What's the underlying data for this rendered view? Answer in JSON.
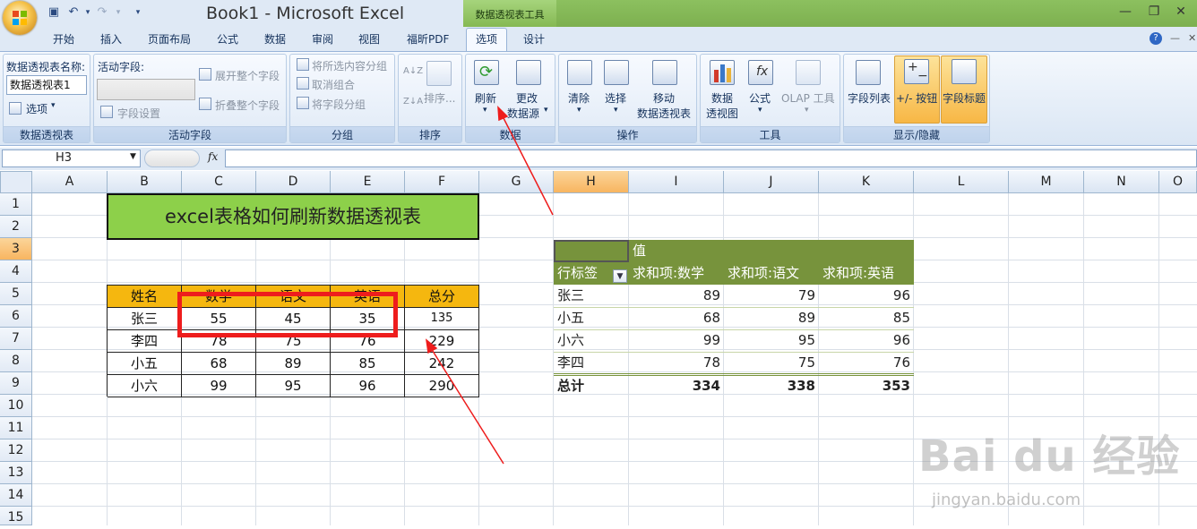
{
  "app": {
    "window_title": "Book1 - Microsoft Excel",
    "context_tab_group": "数据透视表工具"
  },
  "tabs": [
    "开始",
    "插入",
    "页面布局",
    "公式",
    "数据",
    "审阅",
    "视图",
    "福昕PDF",
    "选项",
    "设计"
  ],
  "active_tab": "选项",
  "ribbon": {
    "pivot_group": {
      "name_label": "数据透视表名称:",
      "name_value": "数据透视表1",
      "options": "选项",
      "label": "数据透视表"
    },
    "field_group": {
      "active_field": "活动字段:",
      "expand": "展开整个字段",
      "collapse": "折叠整个字段",
      "field_settings": "字段设置",
      "label": "活动字段"
    },
    "group_group": {
      "group_selection": "将所选内容分组",
      "ungroup": "取消组合",
      "group_field": "将字段分组",
      "label": "分组"
    },
    "sort_group": {
      "sort": "排序...",
      "label": "排序"
    },
    "data_group": {
      "refresh": "刷新",
      "change_1": "更改",
      "change_2": "数据源",
      "label": "数据"
    },
    "actions_group": {
      "clear": "清除",
      "select": "选择",
      "move": "移动",
      "move_2": "数据透视表",
      "label": "操作"
    },
    "tools_group": {
      "pivotchart_1": "数据",
      "pivotchart_2": "透视图",
      "formula": "公式",
      "olap": "OLAP 工具",
      "label": "工具"
    },
    "show_group": {
      "field_list": "字段列表",
      "buttons": "+/- 按钮",
      "headers": "字段标题",
      "label": "显示/隐藏"
    }
  },
  "formula_bar": {
    "name_box": "H3",
    "fx": "fx",
    "formula": ""
  },
  "columns": [
    "A",
    "B",
    "C",
    "D",
    "E",
    "F",
    "G",
    "H",
    "I",
    "J",
    "K",
    "L",
    "M",
    "N",
    "O"
  ],
  "rows": [
    "1",
    "2",
    "3",
    "4",
    "5",
    "6",
    "7",
    "8",
    "9",
    "10",
    "11",
    "12",
    "13",
    "14",
    "15"
  ],
  "selected_cell": "H3",
  "sheet": {
    "title": "excel表格如何刷新数据透视表",
    "table_headers": [
      "姓名",
      "数学",
      "语文",
      "英语",
      "总分"
    ],
    "table_rows": [
      [
        "张三",
        "55",
        "45",
        "35",
        "135"
      ],
      [
        "李四",
        "78",
        "75",
        "76",
        "229"
      ],
      [
        "小五",
        "68",
        "89",
        "85",
        "242"
      ],
      [
        "小六",
        "99",
        "95",
        "96",
        "290"
      ]
    ]
  },
  "pivot": {
    "values_label": "值",
    "row_label": "行标签",
    "headers": [
      "求和项:数学",
      "求和项:语文",
      "求和项:英语"
    ],
    "rows": [
      [
        "张三",
        "89",
        "79",
        "96"
      ],
      [
        "小五",
        "68",
        "89",
        "85"
      ],
      [
        "小六",
        "99",
        "95",
        "96"
      ],
      [
        "李四",
        "78",
        "75",
        "76"
      ]
    ],
    "total": [
      "总计",
      "334",
      "338",
      "353"
    ]
  },
  "watermark": {
    "text": "Bai du 经验",
    "url": "jingyan.baidu.com"
  },
  "colors": {
    "title_fill": "#8dd04a",
    "header_fill": "#f5b70f",
    "pivot_header": "#77933c",
    "annotation_red": "#ee1d1d"
  }
}
